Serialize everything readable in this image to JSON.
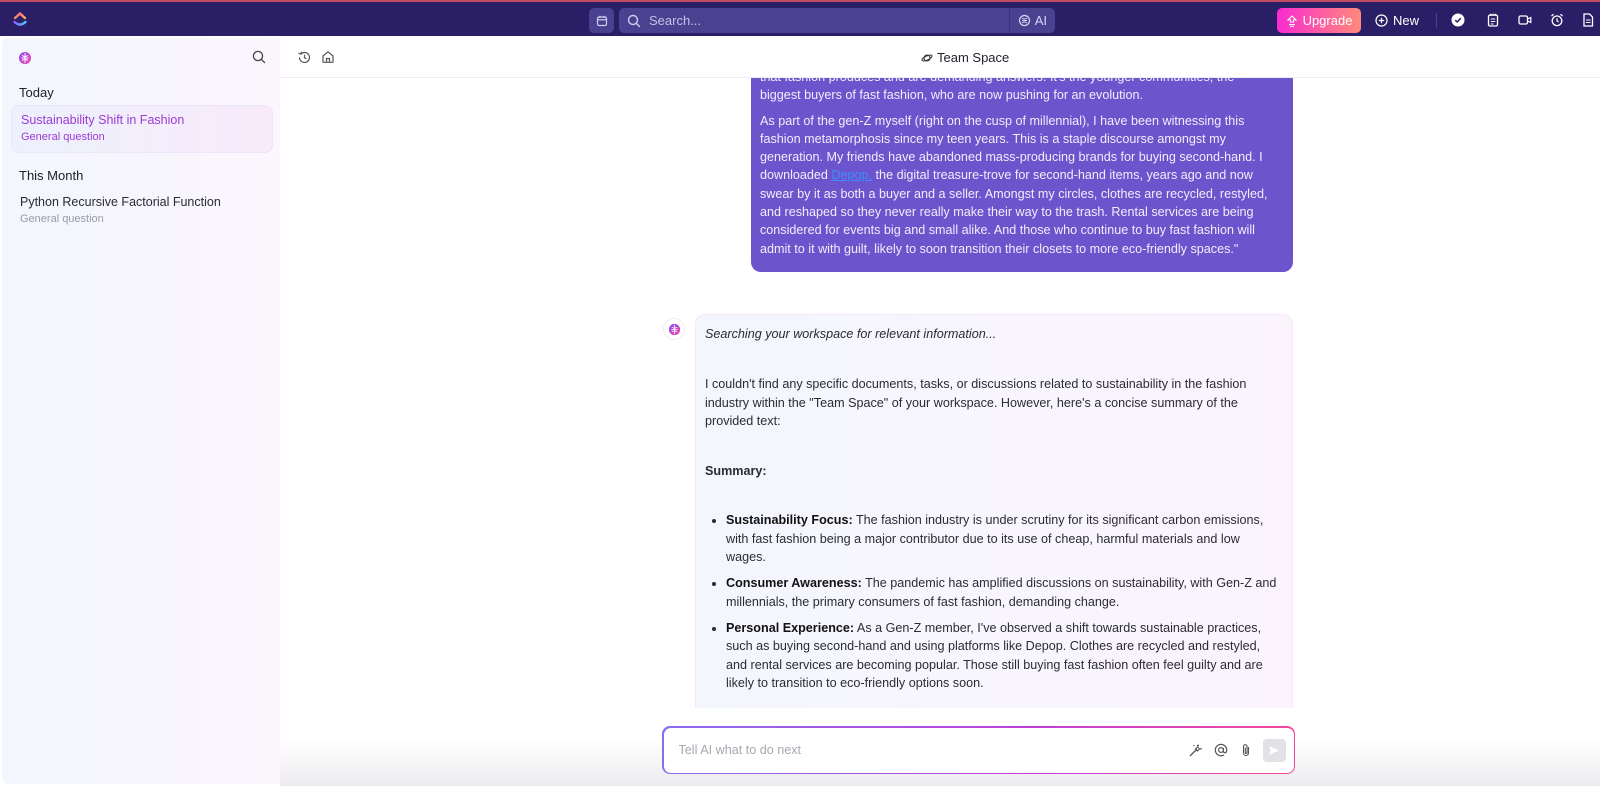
{
  "topbar": {
    "search_placeholder": "Search...",
    "ai_label": "AI",
    "upgrade_label": "Upgrade",
    "new_label": "New",
    "colors": {
      "bar": "#2a1f66",
      "upgrade_start": "#f92bd0",
      "upgrade_end": "#ff8a7a"
    }
  },
  "sidebar": {
    "sections": [
      {
        "title": "Today",
        "items": [
          {
            "title": "Sustainability Shift in Fashion",
            "subtitle": "General question",
            "active": true
          }
        ]
      },
      {
        "title": "This Month",
        "items": [
          {
            "title": "Python Recursive Factorial Function",
            "subtitle": "General question",
            "active": false
          }
        ]
      }
    ]
  },
  "header": {
    "title": "Team Space"
  },
  "chat": {
    "user_message": {
      "para1_tail_line1": "that fashion produces and are demanding answers. It's the younger communities, the",
      "para1_tail_line2": "biggest buyers of fast fashion, who are now pushing for an evolution.",
      "para2_before_link": "As part of the gen-Z myself (right on the cusp of millennial), I have been witnessing this fashion metamorphosis since my teen years. This is a staple discourse amongst my generation. My friends have abandoned mass-producing brands for buying second-hand. I downloaded ",
      "link_text": "Depop,",
      "para2_after_link": " the digital treasure-trove for second-hand items, years ago and now swear by it as both a buyer and a seller. Amongst my circles, clothes are recycled, restyled, and reshaped so they never really make their way to the trash. Rental services are being considered for events big and small alike. And those who continue to buy fast fashion will admit to it with guilt, likely to soon transition their closets to more eco-friendly spaces.\""
    },
    "ai_message": {
      "status": "Searching your workspace for relevant information...",
      "intro": "I couldn't find any specific documents, tasks, or discussions related to sustainability in the fashion industry within the \"Team Space\" of your workspace. However, here's a concise summary of the provided text:",
      "summary_heading": "Summary:",
      "bullets": [
        {
          "label": "Sustainability Focus:",
          "text": " The fashion industry is under scrutiny for its significant carbon emissions, with fast fashion being a major contributor due to its use of cheap, harmful materials and low wages."
        },
        {
          "label": "Consumer Awareness:",
          "text": " The pandemic has amplified discussions on sustainability, with Gen-Z and millennials, the primary consumers of fast fashion, demanding change."
        },
        {
          "label": "Personal Experience:",
          "text": " As a Gen-Z member, I've observed a shift towards sustainable practices, such as buying second-hand and using platforms like Depop. Clothes are recycled and restyled, and rental services are becoming popular. Those still buying fast fashion often feel guilty and are likely to transition to eco-friendly options soon."
        }
      ]
    }
  },
  "composer": {
    "placeholder": "Tell AI what to do next",
    "value": ""
  }
}
